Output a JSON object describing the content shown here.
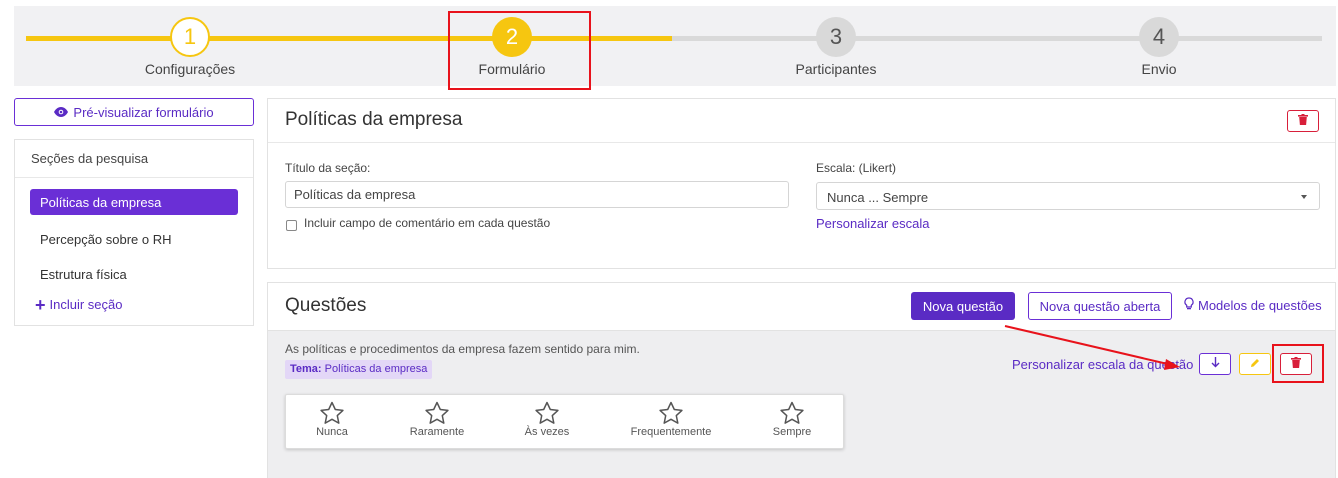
{
  "stepper": {
    "steps": [
      {
        "number": "1",
        "label": "Configurações",
        "state": "done"
      },
      {
        "number": "2",
        "label": "Formulário",
        "state": "active"
      },
      {
        "number": "3",
        "label": "Participantes",
        "state": "todo"
      },
      {
        "number": "4",
        "label": "Envio",
        "state": "todo"
      }
    ]
  },
  "sidebar": {
    "preview_button": "Pré-visualizar formulário",
    "preview_icon": "eye-icon",
    "sections_title": "Seções da pesquisa",
    "items": [
      {
        "label": "Políticas da empresa",
        "active": true
      },
      {
        "label": "Percepção sobre o RH",
        "active": false
      },
      {
        "label": "Estrutura física",
        "active": false
      }
    ],
    "add_section": "Incluir seção"
  },
  "section_panel": {
    "title": "Políticas da empresa",
    "delete_icon": "trash-icon",
    "section_title_label": "Título da seção:",
    "section_title_value": "Políticas da empresa",
    "comment_checkbox_label": "Incluir campo de comentário em cada questão",
    "comment_checkbox_checked": false,
    "scale_label": "Escala: (Likert)",
    "scale_value": "Nunca ... Sempre",
    "customize_scale": "Personalizar escala"
  },
  "questions_panel": {
    "title": "Questões",
    "new_question": "Nova questão",
    "new_open_question": "Nova questão aberta",
    "templates": "Modelos de questões",
    "templates_icon": "lightbulb-icon",
    "question": {
      "text": "As políticas e procedimentos da empresa fazem sentido para mim.",
      "tag_label": "Tema:",
      "tag_value": "Políticas da empresa",
      "customize_scale": "Personalizar escala da questão",
      "move_down_icon": "arrow-down-icon",
      "edit_icon": "pencil-icon",
      "delete_icon": "trash-icon",
      "options": [
        "Nunca",
        "Raramente",
        "Às vezes",
        "Frequentemente",
        "Sempre"
      ],
      "option_icon": "star-icon"
    }
  },
  "colors": {
    "accent": "#5a2bc4",
    "step_yellow": "#f6c610",
    "danger": "#d81f3a",
    "annotation_red": "#e8121b"
  }
}
